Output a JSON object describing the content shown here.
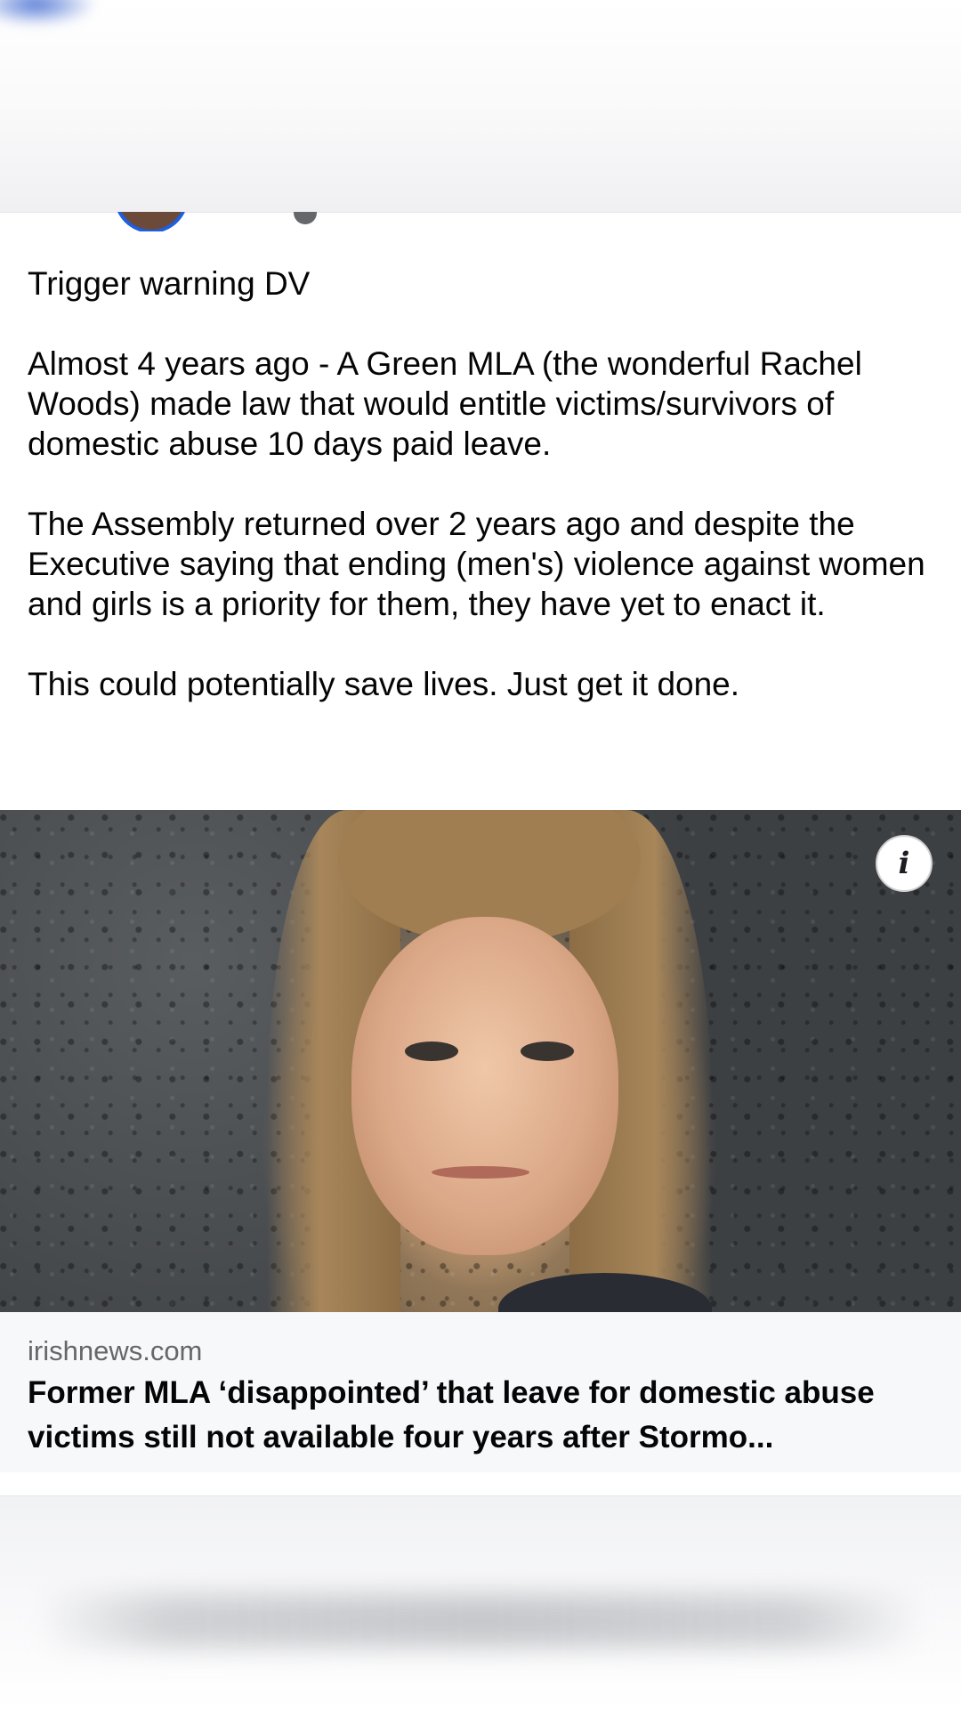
{
  "post": {
    "paragraphs": [
      "Trigger warning DV",
      "Almost 4 years ago - A Green MLA (the wonderful Rachel Woods) made law that would entitle victims/survivors of domestic abuse 10 days paid leave.",
      "The Assembly returned over 2 years ago and despite the Executive saying that ending (men's) violence against women and girls is a priority for them, they have yet to enact it.",
      "This could potentially save lives. Just get it done."
    ]
  },
  "link_preview": {
    "domain": "irishnews.com",
    "title": "Former MLA ‘disappointed’ that leave for domestic abuse victims still not available four years after Stormo...",
    "info_glyph": "i"
  },
  "colors": {
    "avatar_ring": "#1d5fe0",
    "secondary_text": "#65676b",
    "footer_bg": "#f7f8fa"
  }
}
